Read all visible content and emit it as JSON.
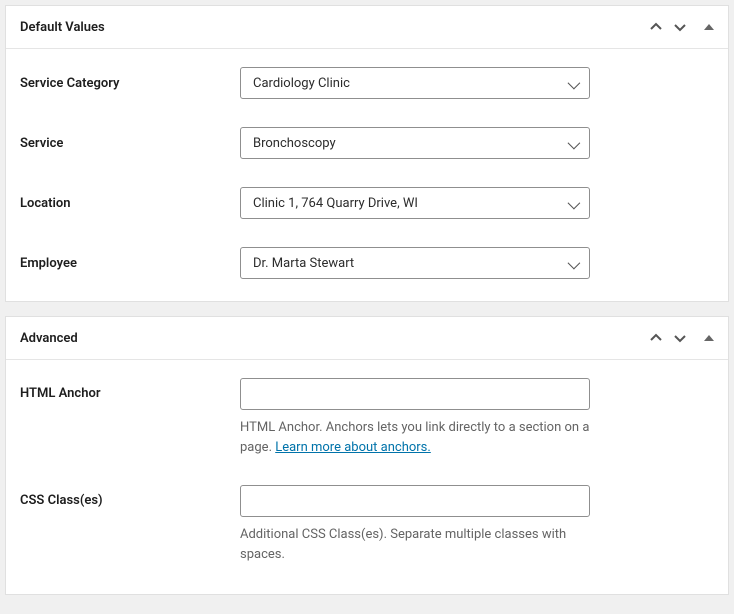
{
  "panels": {
    "default_values": {
      "title": "Default Values",
      "fields": {
        "service_category": {
          "label": "Service Category",
          "value": "Cardiology Clinic"
        },
        "service": {
          "label": "Service",
          "value": "Bronchoscopy"
        },
        "location": {
          "label": "Location",
          "value": "Clinic 1, 764 Quarry Drive, WI"
        },
        "employee": {
          "label": "Employee",
          "value": "Dr. Marta Stewart"
        }
      }
    },
    "advanced": {
      "title": "Advanced",
      "html_anchor": {
        "label": "HTML Anchor",
        "value": "",
        "help_prefix": "HTML Anchor. Anchors lets you link directly to a section on a page. ",
        "help_link_text": "Learn more about anchors."
      },
      "css_classes": {
        "label": "CSS Class(es)",
        "value": "",
        "help": "Additional CSS Class(es). Separate multiple classes with spaces."
      }
    }
  }
}
